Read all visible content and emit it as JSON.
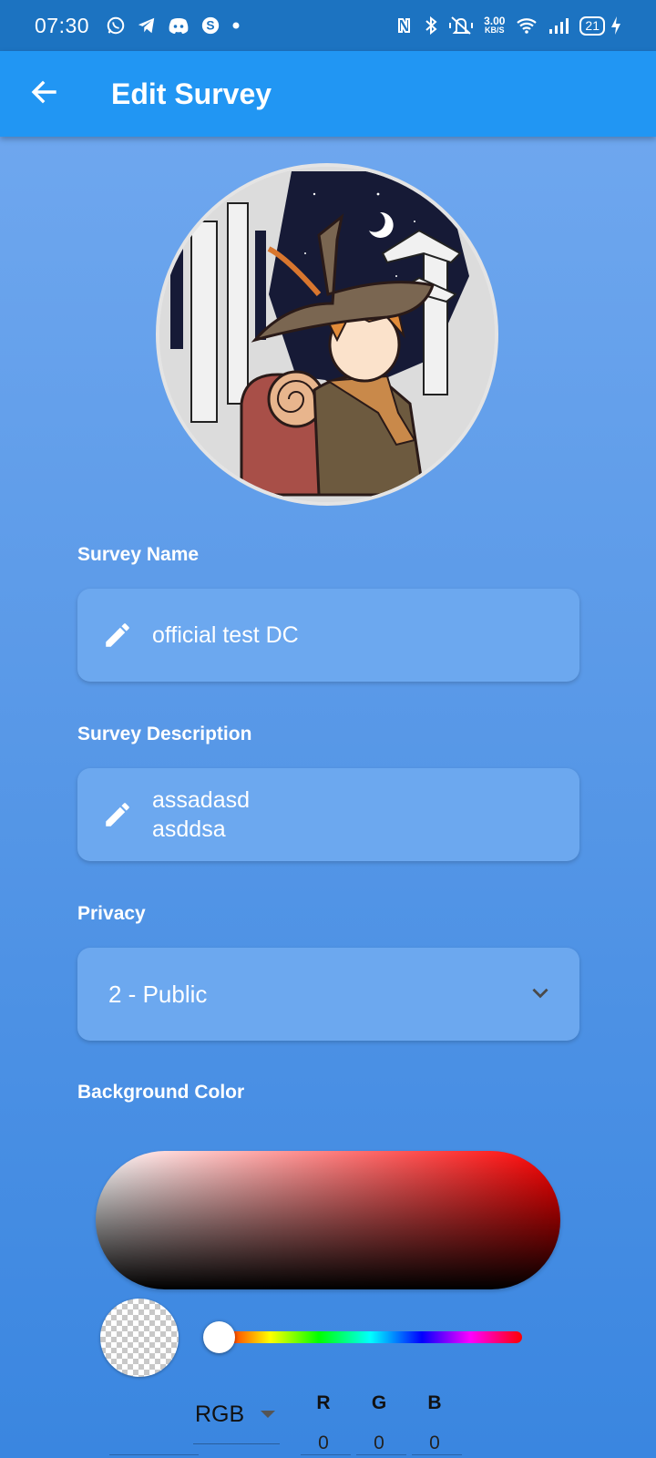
{
  "status_bar": {
    "time": "07:30",
    "speed_value": "3.00",
    "speed_unit": "KB/S",
    "battery": "21",
    "left_icons": [
      "whatsapp-icon",
      "telegram-icon",
      "discord-icon",
      "skype-icon",
      "dot-icon"
    ],
    "right_icons": [
      "nfc-icon",
      "bluetooth-icon",
      "mute-vibrate-icon",
      "wifi-icon",
      "signal-icon",
      "battery-icon",
      "charging-icon"
    ]
  },
  "app_bar": {
    "title": "Edit Survey",
    "back_icon": "arrow-back-icon"
  },
  "form": {
    "name_label": "Survey Name",
    "name_value": "official test DC",
    "description_label": "Survey Description",
    "description_value": "assadasd\nasddsa",
    "privacy_label": "Privacy",
    "privacy_value": "2 - Public",
    "background_label": "Background Color"
  },
  "color_picker": {
    "base_hue_color": "#ff0000",
    "hue": 0,
    "selected_alpha": 0,
    "mode": "RGB",
    "channels": [
      {
        "label": "R",
        "value": "0"
      },
      {
        "label": "G",
        "value": "0"
      },
      {
        "label": "B",
        "value": "0"
      }
    ]
  },
  "colors": {
    "status_bar": "#1c73c1",
    "app_bar": "#2196f3",
    "field_bg": "#6ca8ef",
    "page_top": "#73aaf0",
    "page_bottom": "#3a86e0"
  }
}
